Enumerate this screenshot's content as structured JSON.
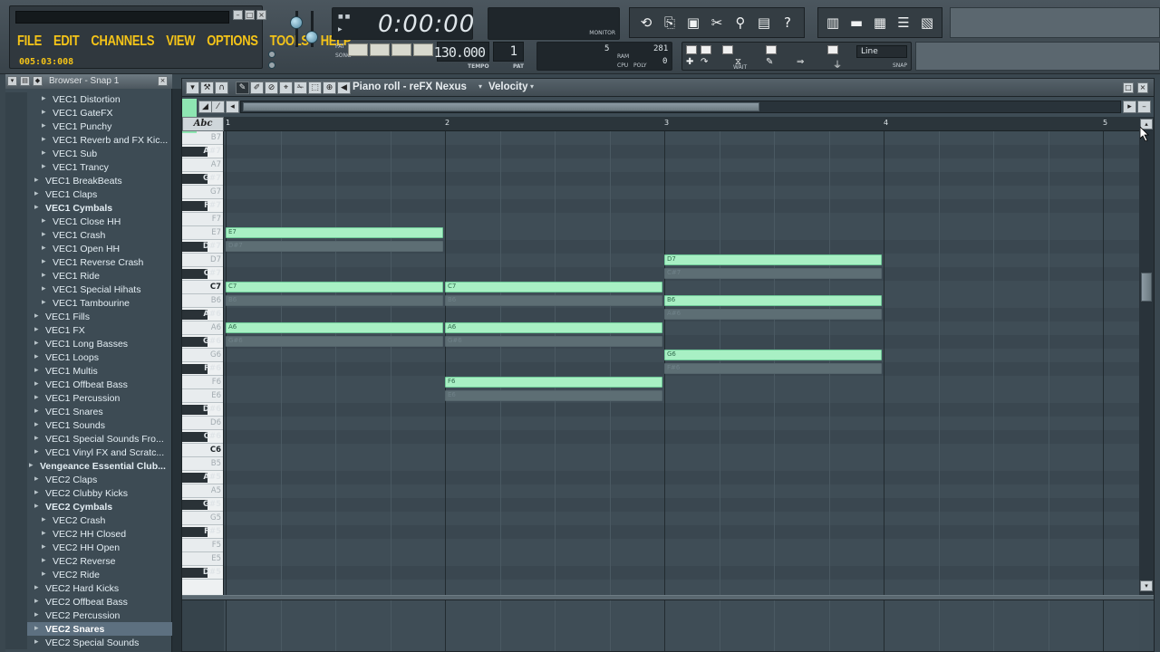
{
  "menu": {
    "items": [
      "FILE",
      "EDIT",
      "CHANNELS",
      "VIEW",
      "OPTIONS",
      "TOOLS",
      "HELP"
    ],
    "clock": "005:03:008"
  },
  "transport": {
    "time": "0:00:00",
    "monitor_label": "MONITOR",
    "pat_label": "PAT",
    "song_label": "SONG",
    "tempo": "130.000",
    "tempo_label": "TEMPO",
    "pattern": "1",
    "pattern_label": "PAT"
  },
  "perf": {
    "value_a": "5",
    "value_b": "281",
    "value_c": "0",
    "ram_label": "RAM",
    "cpu_label": "CPU",
    "poly_label": "POLY"
  },
  "snap": {
    "mode": "Line",
    "label": "SNAP",
    "wait_label": "WAIT"
  },
  "toolbar_icons": [
    "undo-icon",
    "save-icon",
    "export-icon",
    "cut-icon",
    "mic-icon",
    "page-icon",
    "help-icon"
  ],
  "view_icons": [
    "playlist-icon",
    "step-seq-icon",
    "mixer-icon",
    "piano-roll-icon",
    "browser-icon"
  ],
  "browser": {
    "title": "Browser - Snap 1",
    "items": [
      {
        "label": "VEC1 Distortion",
        "indent": 2,
        "bold": false,
        "selected": false
      },
      {
        "label": "VEC1 GateFX",
        "indent": 2,
        "bold": false,
        "selected": false
      },
      {
        "label": "VEC1 Punchy",
        "indent": 2,
        "bold": false,
        "selected": false
      },
      {
        "label": "VEC1 Reverb and FX Kic...",
        "indent": 2,
        "bold": false,
        "selected": false
      },
      {
        "label": "VEC1 Sub",
        "indent": 2,
        "bold": false,
        "selected": false
      },
      {
        "label": "VEC1 Trancy",
        "indent": 2,
        "bold": false,
        "selected": false
      },
      {
        "label": "VEC1 BreakBeats",
        "indent": 1,
        "bold": false,
        "selected": false
      },
      {
        "label": "VEC1 Claps",
        "indent": 1,
        "bold": false,
        "selected": false
      },
      {
        "label": "VEC1 Cymbals",
        "indent": 1,
        "bold": true,
        "selected": false
      },
      {
        "label": "VEC1 Close HH",
        "indent": 2,
        "bold": false,
        "selected": false
      },
      {
        "label": "VEC1 Crash",
        "indent": 2,
        "bold": false,
        "selected": false
      },
      {
        "label": "VEC1 Open HH",
        "indent": 2,
        "bold": false,
        "selected": false
      },
      {
        "label": "VEC1 Reverse Crash",
        "indent": 2,
        "bold": false,
        "selected": false
      },
      {
        "label": "VEC1 Ride",
        "indent": 2,
        "bold": false,
        "selected": false
      },
      {
        "label": "VEC1 Special Hihats",
        "indent": 2,
        "bold": false,
        "selected": false
      },
      {
        "label": "VEC1 Tambourine",
        "indent": 2,
        "bold": false,
        "selected": false
      },
      {
        "label": "VEC1 Fills",
        "indent": 1,
        "bold": false,
        "selected": false
      },
      {
        "label": "VEC1 FX",
        "indent": 1,
        "bold": false,
        "selected": false
      },
      {
        "label": "VEC1 Long Basses",
        "indent": 1,
        "bold": false,
        "selected": false
      },
      {
        "label": "VEC1 Loops",
        "indent": 1,
        "bold": false,
        "selected": false
      },
      {
        "label": "VEC1 Multis",
        "indent": 1,
        "bold": false,
        "selected": false
      },
      {
        "label": "VEC1 Offbeat Bass",
        "indent": 1,
        "bold": false,
        "selected": false
      },
      {
        "label": "VEC1 Percussion",
        "indent": 1,
        "bold": false,
        "selected": false
      },
      {
        "label": "VEC1 Snares",
        "indent": 1,
        "bold": false,
        "selected": false
      },
      {
        "label": "VEC1 Sounds",
        "indent": 1,
        "bold": false,
        "selected": false
      },
      {
        "label": "VEC1 Special Sounds Fro...",
        "indent": 1,
        "bold": false,
        "selected": false
      },
      {
        "label": "VEC1 Vinyl FX and Scratc...",
        "indent": 1,
        "bold": false,
        "selected": false
      },
      {
        "label": "Vengeance Essential Club...",
        "indent": 0,
        "bold": true,
        "selected": false
      },
      {
        "label": "VEC2 Claps",
        "indent": 1,
        "bold": false,
        "selected": false
      },
      {
        "label": "VEC2 Clubby Kicks",
        "indent": 1,
        "bold": false,
        "selected": false
      },
      {
        "label": "VEC2 Cymbals",
        "indent": 1,
        "bold": true,
        "selected": false
      },
      {
        "label": "VEC2 Crash",
        "indent": 2,
        "bold": false,
        "selected": false
      },
      {
        "label": "VEC2 HH Closed",
        "indent": 2,
        "bold": false,
        "selected": false
      },
      {
        "label": "VEC2 HH Open",
        "indent": 2,
        "bold": false,
        "selected": false
      },
      {
        "label": "VEC2 Reverse",
        "indent": 2,
        "bold": false,
        "selected": false
      },
      {
        "label": "VEC2 Ride",
        "indent": 2,
        "bold": false,
        "selected": false
      },
      {
        "label": "VEC2 Hard Kicks",
        "indent": 1,
        "bold": false,
        "selected": false
      },
      {
        "label": "VEC2 Offbeat Bass",
        "indent": 1,
        "bold": false,
        "selected": false
      },
      {
        "label": "VEC2 Percussion",
        "indent": 1,
        "bold": false,
        "selected": false
      },
      {
        "label": "VEC2 Snares",
        "indent": 1,
        "bold": false,
        "selected": true
      },
      {
        "label": "VEC2 Special Sounds",
        "indent": 1,
        "bold": false,
        "selected": false
      }
    ]
  },
  "piano_roll": {
    "title": "Piano roll - reFX Nexus",
    "target": "Velocity",
    "abc_label": "Abc",
    "bars": [
      "1",
      "2",
      "3",
      "4",
      "5"
    ],
    "top_note": "C8",
    "keys": [
      "B7",
      "A#7",
      "A7",
      "G#7",
      "G7",
      "F#7",
      "F7",
      "E7",
      "D#7",
      "D7",
      "C#7",
      "C7",
      "B6",
      "A#6",
      "A6",
      "G#6",
      "G6",
      "F#6",
      "F6",
      "E6",
      "D#6",
      "D6",
      "C#6",
      "C6",
      "B5",
      "A#5",
      "A5",
      "G#5",
      "G5",
      "F#5",
      "F5",
      "E5",
      "D#5"
    ],
    "notes": [
      {
        "label": "E7",
        "key": "E7",
        "start": 1,
        "length": 1
      },
      {
        "label": "C7",
        "key": "C7",
        "start": 1,
        "length": 1
      },
      {
        "label": "A6",
        "key": "A6",
        "start": 1,
        "length": 1
      },
      {
        "label": "C7",
        "key": "C7",
        "start": 2,
        "length": 1
      },
      {
        "label": "A6",
        "key": "A6",
        "start": 2,
        "length": 1
      },
      {
        "label": "F6",
        "key": "F6",
        "start": 2,
        "length": 1
      },
      {
        "label": "D7",
        "key": "D7",
        "start": 3,
        "length": 1
      },
      {
        "label": "B6",
        "key": "B6",
        "start": 3,
        "length": 1
      },
      {
        "label": "G6",
        "key": "G6",
        "start": 3,
        "length": 1
      }
    ],
    "ghost_notes": [
      {
        "label": "D#7",
        "key": "D#7",
        "start": 1,
        "length": 1
      },
      {
        "label": "B6",
        "key": "B6",
        "start": 1,
        "length": 1
      },
      {
        "label": "G#6",
        "key": "G#6",
        "start": 1,
        "length": 1
      },
      {
        "label": "B6",
        "key": "B6",
        "start": 2,
        "length": 1
      },
      {
        "label": "G#6",
        "key": "G#6",
        "start": 2,
        "length": 1
      },
      {
        "label": "E6",
        "key": "E6",
        "start": 2,
        "length": 1
      },
      {
        "label": "C#7",
        "key": "C#7",
        "start": 3,
        "length": 1
      },
      {
        "label": "A#6",
        "key": "A#6",
        "start": 3,
        "length": 1
      },
      {
        "label": "F#6",
        "key": "F#6",
        "start": 3,
        "length": 1
      }
    ]
  }
}
